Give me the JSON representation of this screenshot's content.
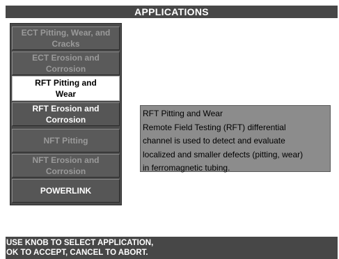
{
  "header": {
    "title": "APPLICATIONS"
  },
  "applications": [
    {
      "line1": "ECT Pitting, Wear, and",
      "line2": "Cracks",
      "state": "disabled"
    },
    {
      "line1": "ECT Erosion and",
      "line2": "Corrosion",
      "state": "disabled"
    },
    {
      "line1": "RFT Pitting and",
      "line2": "Wear",
      "state": "selected"
    },
    {
      "line1": "RFT Erosion and",
      "line2": "Corrosion",
      "state": "enabled"
    },
    {
      "line1": "NFT Pitting",
      "line2": "",
      "state": "disabled"
    },
    {
      "line1": "NFT Erosion and",
      "line2": "Corrosion",
      "state": "disabled"
    },
    {
      "line1": "POWERLINK",
      "line2": "",
      "state": "enabled"
    }
  ],
  "description": {
    "title": "RFT Pitting and  Wear",
    "lines": [
      "Remote Field Testing (RFT) differential",
      "channel is used to detect and evaluate",
      "localized and smaller defects (pitting, wear)",
      "in ferromagnetic tubing."
    ]
  },
  "footer": {
    "line1": "USE KNOB TO SELECT APPLICATION,",
    "line2": "OK TO ACCEPT, CANCEL TO ABORT."
  },
  "colors": {
    "bar_background": "#474747",
    "list_background": "#4a4a4a",
    "item_enabled_text": "#ffffff",
    "item_disabled_text": "#9a9a9a",
    "item_selected_background": "#ffffff",
    "description_background": "#8c8c8c"
  }
}
